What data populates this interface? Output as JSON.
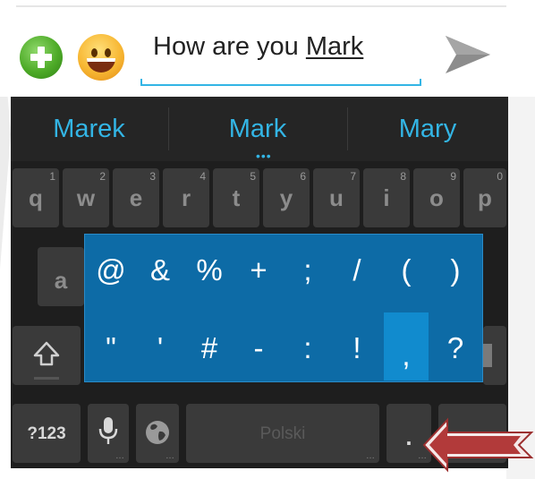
{
  "compose": {
    "message_prefix": "How are you ",
    "message_word": "Mark",
    "add_icon": "add-icon",
    "emoji_icon": "emoji-icon",
    "send_icon": "send-icon"
  },
  "suggestions": [
    "Marek",
    "Mark",
    "Mary"
  ],
  "keyboard": {
    "row1": [
      {
        "label": "q",
        "hint": "1"
      },
      {
        "label": "w",
        "hint": "2"
      },
      {
        "label": "e",
        "hint": "3"
      },
      {
        "label": "r",
        "hint": "4"
      },
      {
        "label": "t",
        "hint": "5"
      },
      {
        "label": "y",
        "hint": "6"
      },
      {
        "label": "u",
        "hint": "7"
      },
      {
        "label": "i",
        "hint": "8"
      },
      {
        "label": "o",
        "hint": "9"
      },
      {
        "label": "p",
        "hint": "0"
      }
    ],
    "row2_visible": "a",
    "symbols_key": "?123",
    "space_label": "Polski",
    "period_key": ".",
    "shift_icon": "shift-icon",
    "mic_icon": "microphone-icon",
    "globe_icon": "globe-icon"
  },
  "popup": {
    "row1": [
      "@",
      "&",
      "%",
      "+",
      ";",
      "/",
      "(",
      ")"
    ],
    "row2": [
      "\"",
      "'",
      "#",
      "-",
      ":",
      "!",
      ",",
      "?"
    ],
    "selected": ","
  },
  "colors": {
    "accent": "#33b5e5",
    "popup_bg": "#0d6ba6",
    "popup_selected": "#118bce",
    "annotation_arrow": "#b23a3a"
  }
}
